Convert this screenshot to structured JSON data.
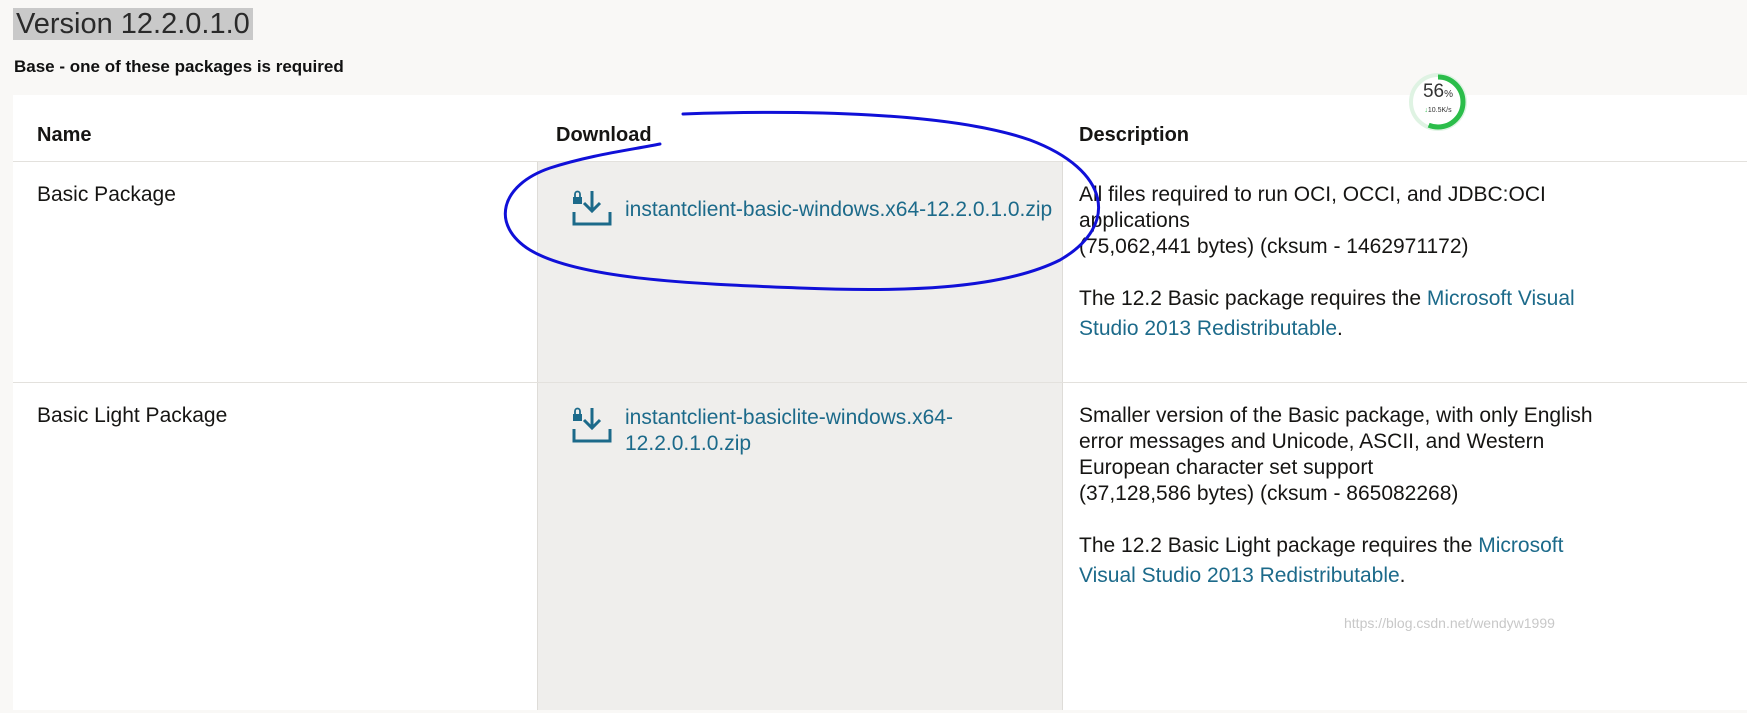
{
  "header": {
    "version_title": "Version 12.2.0.1.0",
    "subtitle": "Base - one of these packages is required"
  },
  "table": {
    "columns": [
      "Name",
      "Download",
      "Description"
    ],
    "rows": [
      {
        "name": "Basic Package",
        "download_lines": [
          "instantclient-basic-windows.x64-12.2.0.1.0.zip"
        ],
        "desc_lines": [
          "All files required to run OCI, OCCI, and JDBC:OCI",
          "applications",
          "(75,062,441 bytes) (cksum - 1462971172)"
        ],
        "requires_prefix": "The 12.2 Basic package requires the ",
        "requires_link_lines": [
          "Microsoft Visual",
          "Studio 2013 Redistributable"
        ],
        "requires_suffix": "."
      },
      {
        "name": "Basic Light Package",
        "download_lines": [
          "instantclient-basiclite-windows.x64-",
          "12.2.0.1.0.zip"
        ],
        "desc_lines": [
          "Smaller version of the Basic package, with only English",
          "error messages and Unicode, ASCII, and Western",
          "European character set support",
          "(37,128,586 bytes) (cksum - 865082268)"
        ],
        "requires_prefix": "The 12.2 Basic Light package requires the ",
        "requires_link_lines": [
          "Microsoft",
          "Visual Studio 2013 Redistributable"
        ],
        "requires_suffix": "."
      }
    ]
  },
  "download_widget": {
    "percent": "56",
    "percent_unit": "%",
    "speed": "10.5K/s",
    "progress_fraction": 0.56,
    "ring_color": "#2bbd4a"
  },
  "colors": {
    "link": "#1c6a8a",
    "annotation": "#1010d8"
  },
  "watermark": "https://blog.csdn.net/wendyw1999"
}
